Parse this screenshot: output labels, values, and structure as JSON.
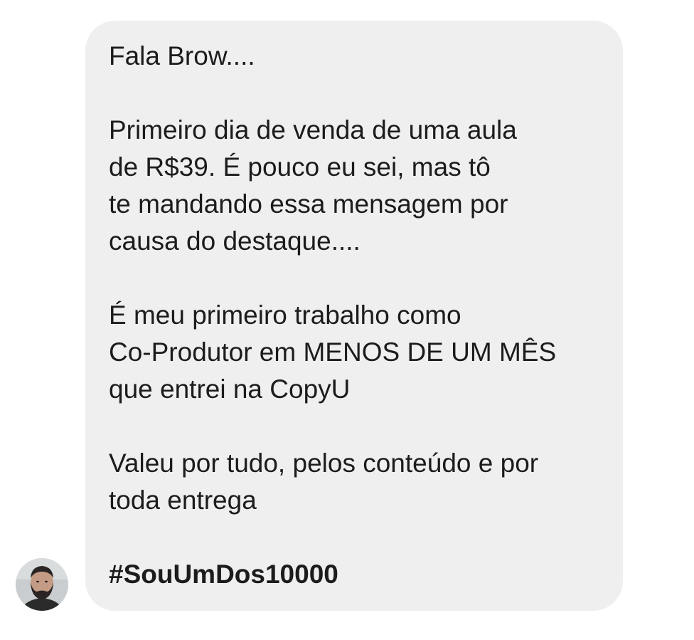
{
  "conversation": {
    "message": {
      "paragraphs": [
        "Fala Brow....",
        "Primeiro dia de venda de uma aula\nde R$39. É pouco eu sei, mas tô\nte mandando essa mensagem por\ncausa do destaque....",
        "É meu primeiro trabalho como\nCo-Produtor em MENOS DE UM MÊS\nque entrei na CopyU",
        "Valeu por tudo, pelos conteúdo e por\ntoda entrega"
      ],
      "hashtag": "#SouUmDos10000"
    },
    "colors": {
      "bubble_background": "#efefef",
      "text": "#1c1c1c",
      "page_background": "#ffffff"
    }
  }
}
